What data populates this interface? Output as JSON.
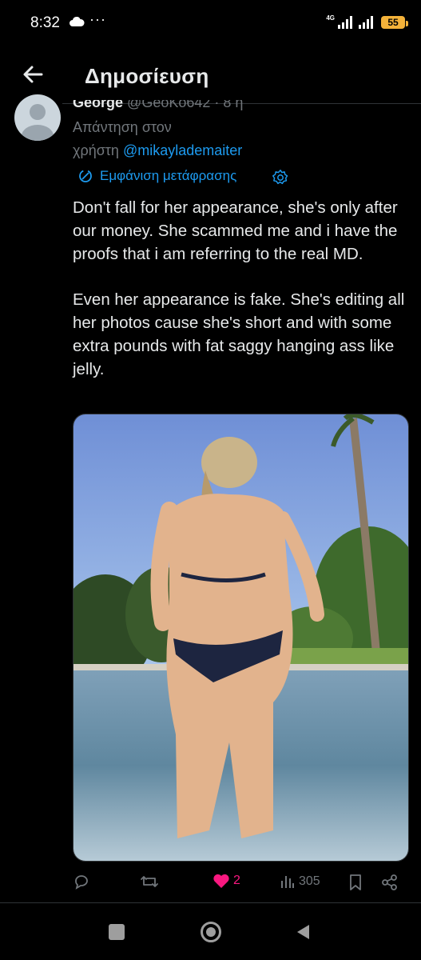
{
  "status_bar": {
    "time": "8:32",
    "more": "···",
    "network_label": "4G",
    "battery": "55",
    "icons": [
      "cloud-icon",
      "signal-icon",
      "signal-icon",
      "battery-icon"
    ]
  },
  "header": {
    "title": "Δημοσίευση",
    "back_icon": "arrow-left-icon"
  },
  "post": {
    "author_name": "George",
    "author_handle": "@GeoKo642",
    "time": "· 8 η",
    "reply_prefix": "Απάντηση στον",
    "reply_to_label": "χρήστη",
    "reply_to_handle": "@mikaylademaiter",
    "translate_label": "Εμφάνιση μετάφρασης",
    "text": "Don't fall for her appearance, she's only after our money. She scammed me and i have the proofs that i am referring to the real MD.\n\nEven her appearance is fake. She's editing all her photos cause she's short and with some extra pounds with fat saggy hanging ass like jelly.",
    "media_icon": "photo-icon"
  },
  "actions": {
    "reply_count": "",
    "repost_count": "",
    "like_count": "2",
    "views_count": "305",
    "colors": {
      "liked": "#f91880",
      "muted": "#71767b",
      "link": "#1d9bf0"
    }
  },
  "nav": {
    "icons": [
      "recents-icon",
      "home-icon",
      "back-icon"
    ]
  }
}
